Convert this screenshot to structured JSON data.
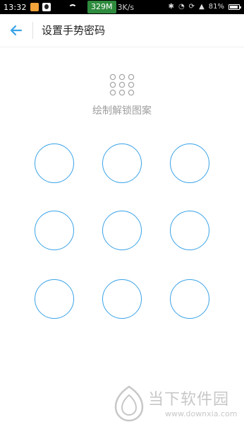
{
  "status_bar": {
    "time": "13:32",
    "speed_value": "329M",
    "speed_unit": "3K/s",
    "battery_percent": "81%",
    "icons": [
      "app-notification-icon",
      "qq-icon",
      "wifi-icon",
      "bluetooth-icon",
      "alarm-icon",
      "sync-icon",
      "signal-icon",
      "battery-icon"
    ]
  },
  "header": {
    "back_icon": "arrow-left-icon",
    "title": "设置手势密码"
  },
  "hint": {
    "icon": "pattern-dots-icon",
    "text": "绘制解锁图案"
  },
  "pattern": {
    "nodes": [
      "1",
      "2",
      "3",
      "4",
      "5",
      "6",
      "7",
      "8",
      "9"
    ],
    "node_color": "#3aa3e8"
  },
  "watermark": {
    "name": "当下软件园",
    "url": "www.downxia.com"
  },
  "colors": {
    "accent": "#3aa3e8",
    "hint_gray": "#9e9e9e",
    "status_bar_bg": "#000000",
    "speed_badge": "#2e8b3e"
  }
}
